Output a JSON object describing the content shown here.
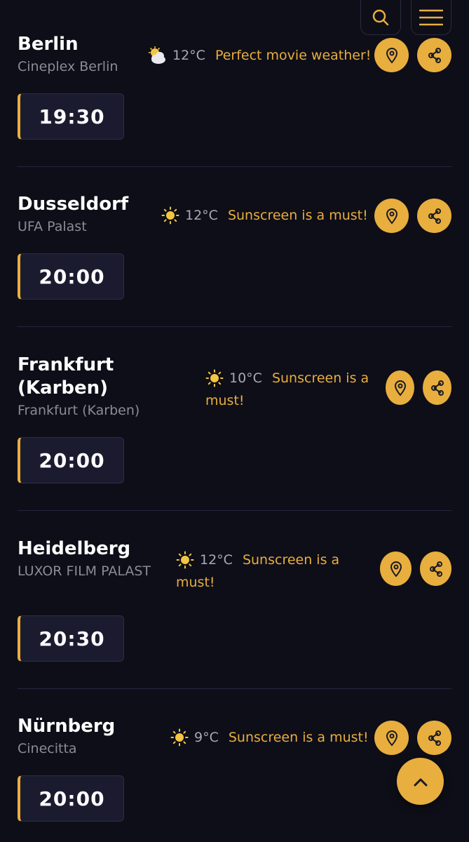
{
  "colors": {
    "background": "#0e0e18",
    "accent": "#e8ae3e",
    "muted": "#8b8b99",
    "divider": "#262640"
  },
  "header": {
    "search_icon": "search-icon",
    "menu_icon": "hamburger-menu-icon"
  },
  "showings": [
    {
      "city": "Berlin",
      "venue": "Cineplex Berlin",
      "weather_icon": "partly-cloudy-icon",
      "temp": "12°C",
      "message": "Perfect movie weather!",
      "time": "19:30"
    },
    {
      "city": "Dusseldorf",
      "venue": "UFA Palast",
      "weather_icon": "sun-icon",
      "temp": "12°C",
      "message": "Sunscreen is a must!",
      "time": "20:00"
    },
    {
      "city": "Frankfurt (Karben)",
      "venue": "Frankfurt (Karben)",
      "weather_icon": "sun-icon",
      "temp": "10°C",
      "message": "Sunscreen is a must!",
      "time": "20:00"
    },
    {
      "city": "Heidelberg",
      "venue": "LUXOR FILM PALAST",
      "weather_icon": "sun-icon",
      "temp": "12°C",
      "message": "Sunscreen is a must!",
      "time": "20:30"
    },
    {
      "city": "Nürnberg",
      "venue": "Cinecitta",
      "weather_icon": "sun-icon",
      "temp": "9°C",
      "message": "Sunscreen is a must!",
      "time": "20:00"
    }
  ],
  "scroll_top_icon": "chevron-up-icon"
}
